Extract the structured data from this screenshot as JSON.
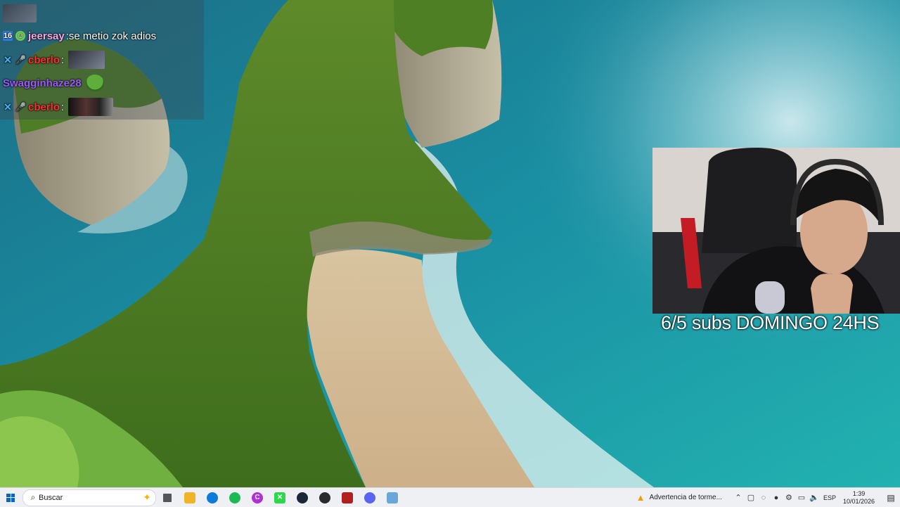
{
  "chat": {
    "messages": [
      {
        "user": "jeersay",
        "user_color": "#f7a8e0",
        "message": "se metio zok adios",
        "badges": [
          "16-icon",
          "smiley-icon"
        ],
        "emote": ""
      },
      {
        "user": "cberlo",
        "user_color": "#ff3030",
        "message": "",
        "badges": [
          "sword-icon",
          "mic-icon"
        ],
        "emote": "photo-emote"
      },
      {
        "user": "Swagginhaze28",
        "user_color": "#9b59ff",
        "message": "",
        "badges": [],
        "emote": "pepe-emote"
      },
      {
        "user": "cberlo",
        "user_color": "#ff3030",
        "message": "",
        "badges": [
          "sword-icon",
          "mic-icon"
        ],
        "emote": "dark-emote"
      }
    ]
  },
  "overlay": {
    "promo_text": "6/5 subs DOMINGO 24HS"
  },
  "taskbar": {
    "search_placeholder": "Buscar",
    "apps": [
      {
        "icon": "task-view-icon",
        "color": "#555555"
      },
      {
        "icon": "file-explorer-icon",
        "color": "#f0b429"
      },
      {
        "icon": "edge-icon",
        "color": "#0f7bd8"
      },
      {
        "icon": "spotify-icon",
        "color": "#1db954"
      },
      {
        "icon": "c-app-icon",
        "color": "#b02fd6"
      },
      {
        "icon": "green-app-icon",
        "color": "#2fd84b"
      },
      {
        "icon": "steam-icon",
        "color": "#1b2838"
      },
      {
        "icon": "obs-icon",
        "color": "#2a2a2a"
      },
      {
        "icon": "voicemeeter-icon",
        "color": "#b0201f"
      },
      {
        "icon": "discord-icon",
        "color": "#5865f2"
      },
      {
        "icon": "notepad-icon",
        "color": "#6aa7d8"
      }
    ],
    "weather_alert": "Advertencia de torme...",
    "language": "ESP",
    "time": "1:39",
    "date": "10/01/2026"
  }
}
